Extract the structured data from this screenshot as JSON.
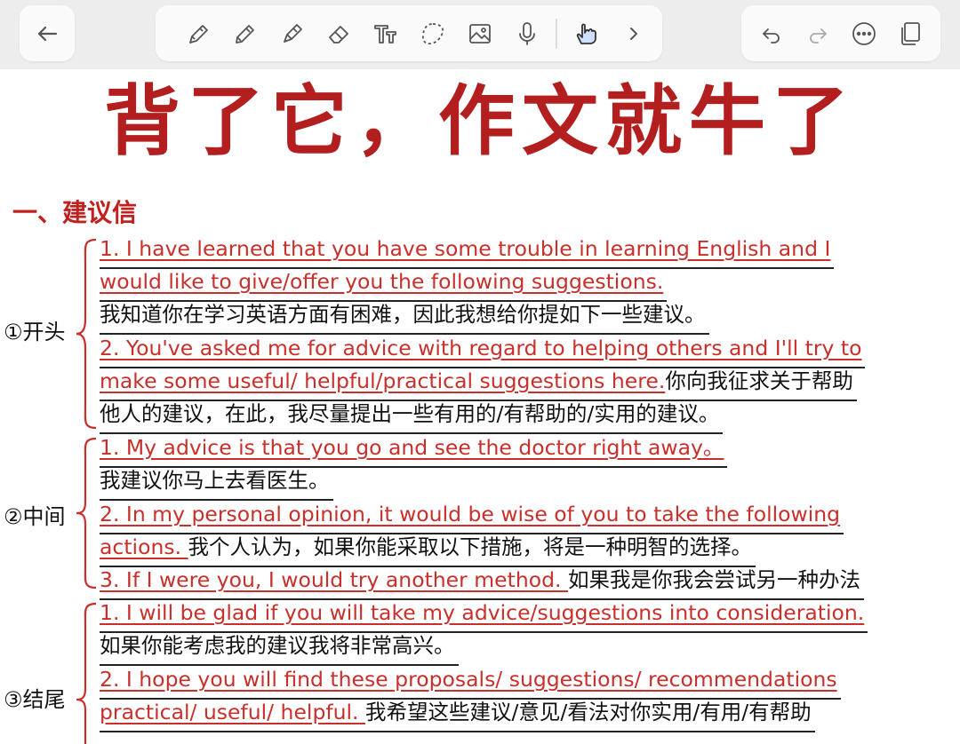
{
  "toolbar": {
    "back_icon": "arrow-left-icon",
    "tools": [
      "pen-icon",
      "pencil-icon",
      "highlighter-icon",
      "eraser-icon",
      "text-tool-icon",
      "lasso-icon",
      "image-icon",
      "microphone-icon",
      "hand-pointer-icon",
      "chevron-right-icon"
    ],
    "right_actions": [
      "undo-icon",
      "redo-icon",
      "more-icon",
      "pages-icon"
    ]
  },
  "page": {
    "title": "背了它，作文就牛了",
    "section_heading": "一、建议信",
    "groups": [
      {
        "label": "①开头",
        "lines": [
          {
            "en": "1. I have learned that you have some trouble in learning English and I",
            "zh": ""
          },
          {
            "en": "would like to give/offer you the following suggestions.",
            "zh": ""
          },
          {
            "en": "",
            "zh": "我知道你在学习英语方面有困难，因此我想给你提如下一些建议。"
          },
          {
            "en": "2. You've asked me for advice with regard to helping others and I'll try to",
            "zh": ""
          },
          {
            "en": "make some useful/ helpful/practical suggestions here.",
            "zh": "你向我征求关于帮助"
          },
          {
            "en": "",
            "zh": "他人的建议，在此，我尽量提出一些有用的/有帮助的/实用的建议。"
          }
        ]
      },
      {
        "label": "②中间",
        "lines": [
          {
            "en": "1. My advice is that you go and see the doctor right away。",
            "zh": ""
          },
          {
            "en": "",
            "zh": "我建议你马上去看医生。"
          },
          {
            "en": "2. In my personal opinion, it would be wise of you to take the following",
            "zh": ""
          },
          {
            "en": "actions. ",
            "zh": "我个人认为，如果你能采取以下措施，将是一种明智的选择。"
          },
          {
            "en": "3. If I were you, I would try another method. ",
            "zh": "如果我是你我会尝试另一种办法"
          }
        ]
      },
      {
        "label": "③结尾",
        "lines": [
          {
            "en": "1. I will be glad if you will take my advice/suggestions into consideration.",
            "zh": ""
          },
          {
            "en": "",
            "zh": "如果你能考虑我的建议我将非常高兴。"
          },
          {
            "en": "2. I hope you will find these proposals/ suggestions/ recommendations",
            "zh": ""
          },
          {
            "en": "practical/ useful/ helpful. ",
            "zh": "我希望这些建议/意见/看法对你实用/有用/有帮助"
          }
        ]
      }
    ]
  },
  "colors": {
    "title": "#b31e1e",
    "english_text": "#c8302c",
    "chinese_text": "#111111",
    "toolbar_bg": "#ededed"
  }
}
